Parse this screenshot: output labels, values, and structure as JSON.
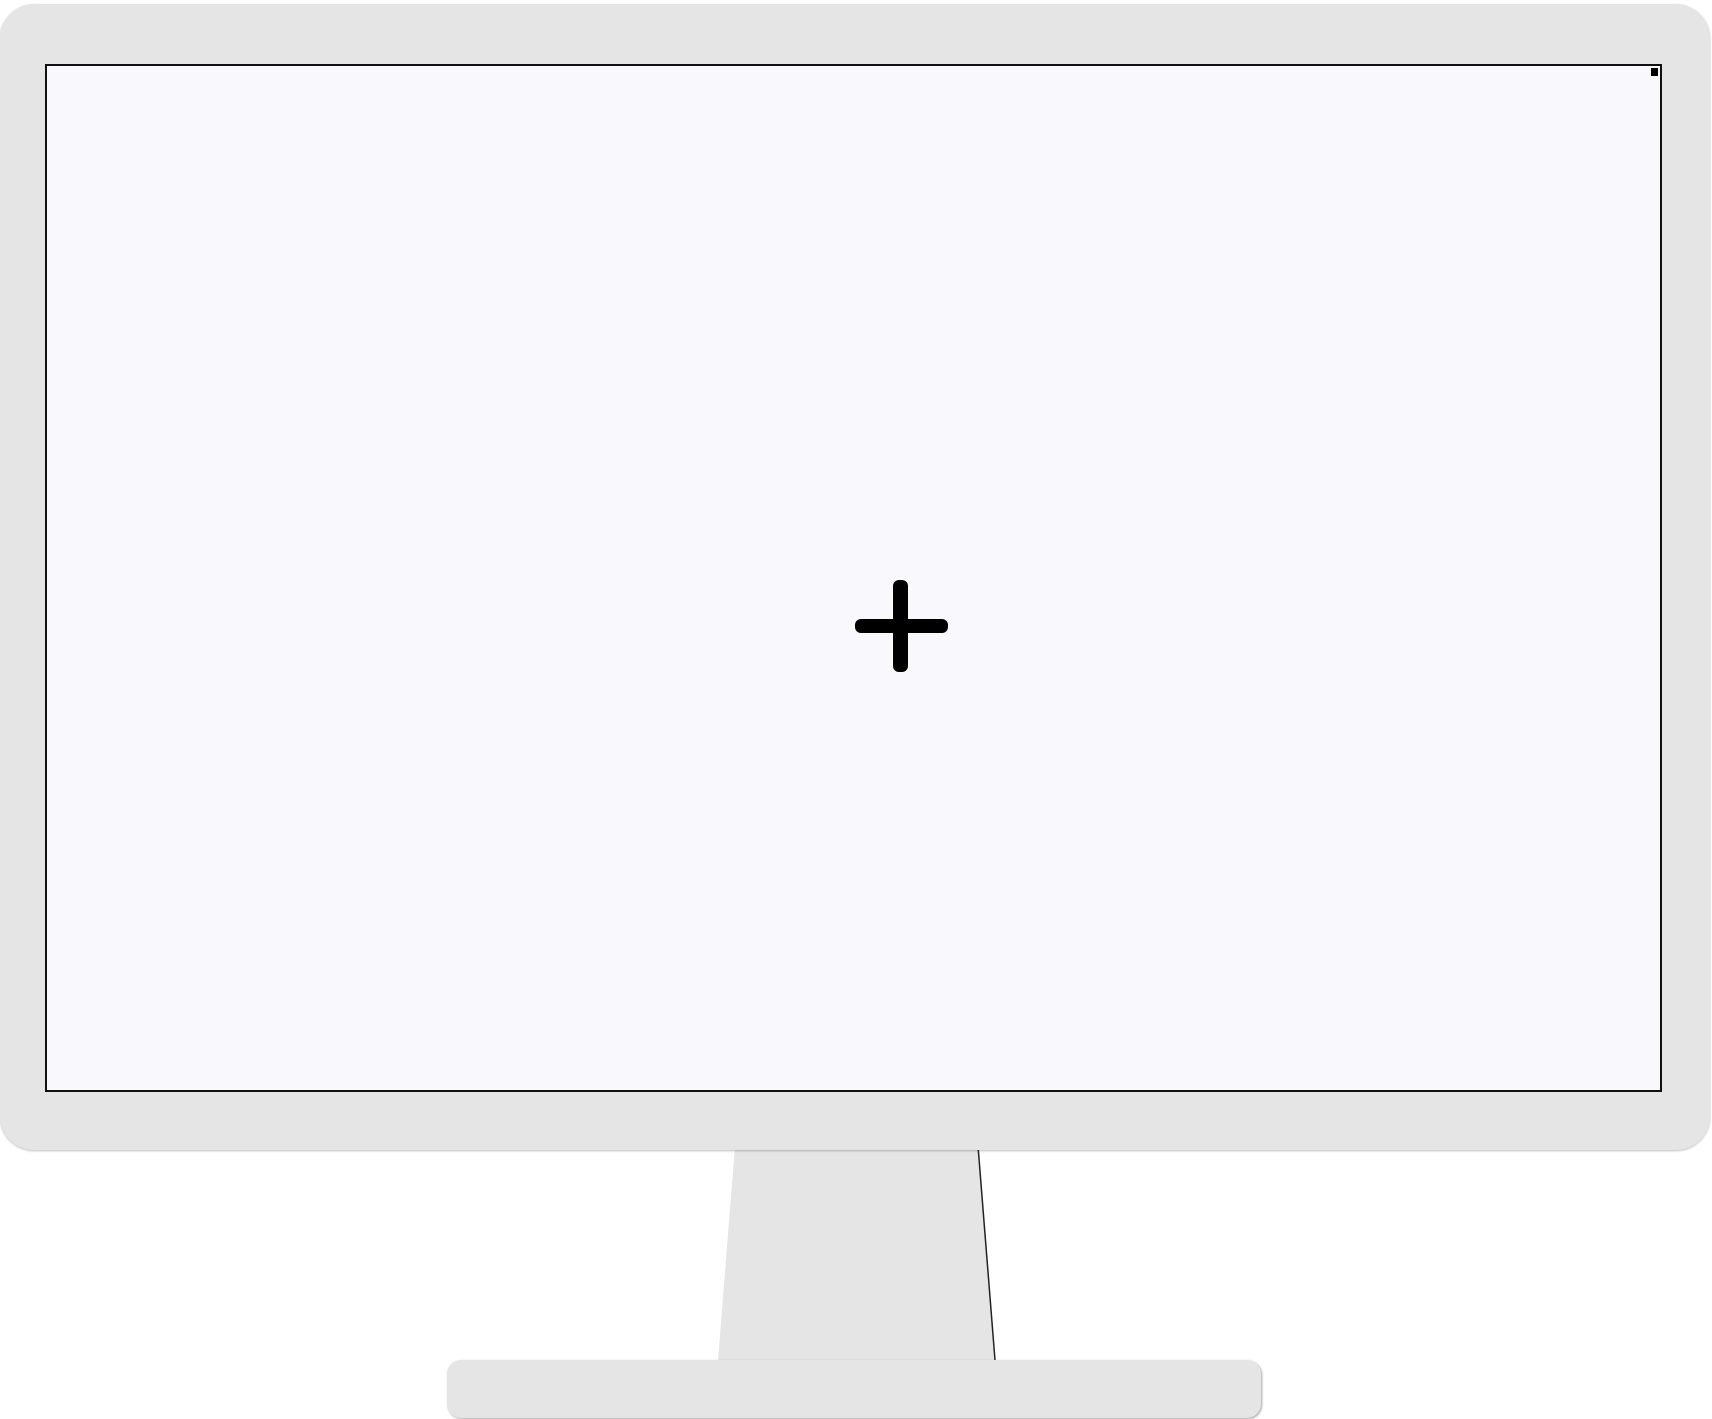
{
  "display": {
    "screen_content": "blank",
    "center_marker_icon": "plus-icon",
    "corner_marker_icon": "square-icon"
  },
  "colors": {
    "bezel": "#e5e5e5",
    "screen": "#f9f9fd",
    "screen_border": "#111111",
    "marker": "#000000"
  }
}
